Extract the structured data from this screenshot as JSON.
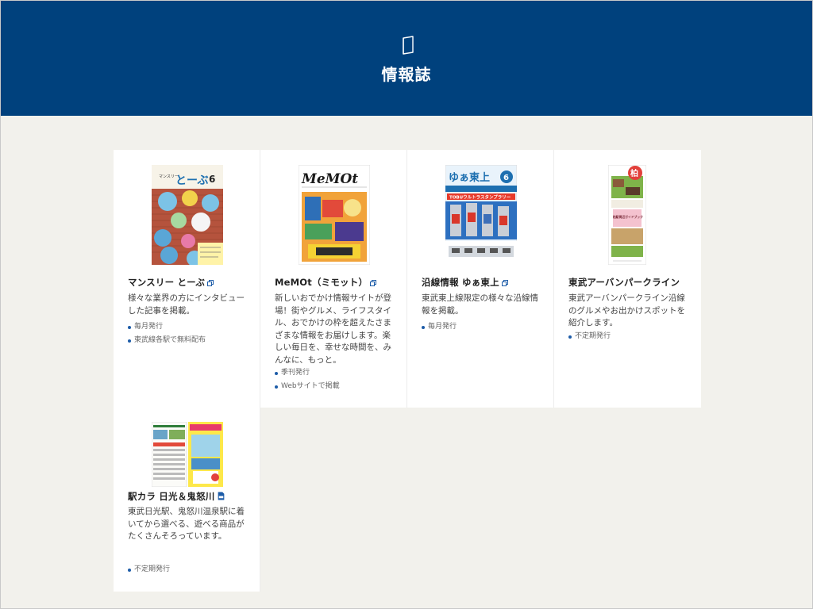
{
  "header": {
    "icon": "magazine-icon",
    "title": "情報誌",
    "color": "#00417d"
  },
  "accent": "#1d5ca8",
  "cards": [
    {
      "title": "マンスリー とーぶ",
      "title_icon": "external-link-icon",
      "description": "様々な業界の方にインタビューした記事を掲載。",
      "meta": [
        "毎月発行",
        "東武線各駅で無料配布"
      ],
      "cover": {
        "brand": "マンスリー",
        "logo": "とーぶ",
        "number": "6"
      }
    },
    {
      "title": "MeMOt（ミモット）",
      "title_icon": "external-link-icon",
      "description": "新しいおでかけ情報サイトが登場！街やグルメ、ライフスタイル、おでかけの枠を超えたさまざまな情報をお届けします。楽しい毎日を、幸せな時間を、みんなに、もっと。",
      "meta": [
        "季刊発行",
        "Webサイトで掲載"
      ],
      "cover": {
        "logo": "MeMOt"
      }
    },
    {
      "title": "沿線情報 ゆぁ東上",
      "title_icon": "external-link-icon",
      "description": "東武東上線限定の様々な沿線情報を掲載。",
      "meta": [
        "毎月発行"
      ],
      "cover": {
        "logo": "ゆぁ東上",
        "number": "6",
        "banner": "TOBUウルトラスタンプラリー"
      }
    },
    {
      "title": "東武アーバンパークライン",
      "title_icon": "",
      "description": "東武アーバンパークライン沿線のグルメやお出かけスポットを紹介します。",
      "meta": [
        "不定期発行"
      ],
      "cover": {
        "badge": "柏",
        "text": "柏駅周辺ガイドブック"
      }
    },
    {
      "title": "駅カラ 日光＆鬼怒川",
      "title_icon": "pdf-icon",
      "description": "東武日光駅、鬼怒川温泉駅に着いてから選べる、遊べる商品がたくさんそろっています。",
      "meta": [
        "不定期発行"
      ],
      "cover": {}
    }
  ]
}
